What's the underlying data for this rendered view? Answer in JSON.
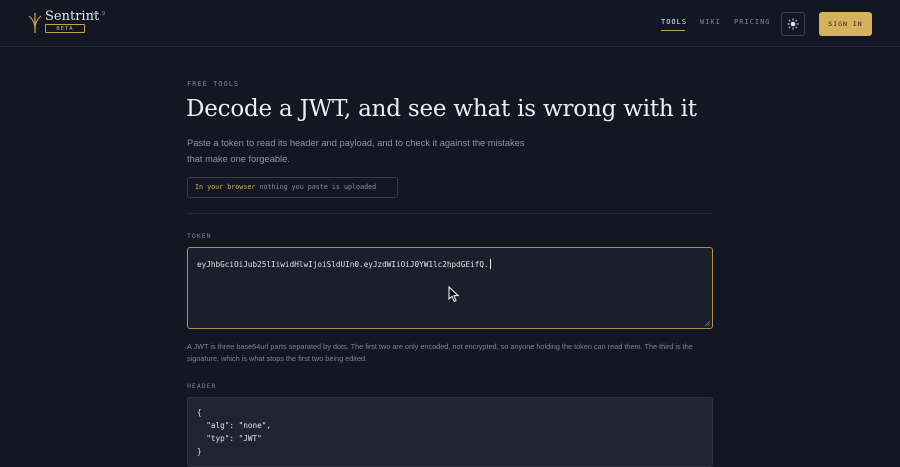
{
  "brand": {
    "name": "Sentrint",
    "version": "v0.9",
    "badge": "BETA"
  },
  "nav": {
    "links": [
      {
        "label": "TOOLS",
        "active": true
      },
      {
        "label": "WIKI",
        "active": false
      },
      {
        "label": "PRICING",
        "active": false
      }
    ],
    "theme_toggle_icon": "sun-icon",
    "signin_label": "SIGN IN"
  },
  "hero": {
    "eyebrow": "FREE TOOLS",
    "title": "Decode a JWT, and see what is wrong with it",
    "lead": "Paste a token to read its header and payload, and to check it against the mistakes that make one forgeable.",
    "privacy_highlight": "In your browser",
    "privacy_rest": " nothing you paste is uploaded"
  },
  "token": {
    "label": "TOKEN",
    "value": "eyJhbGciOiJub25lIiwidHlwIjoiSldUIn0.eyJzdWIiOiJ0YW1lc2hpdGEifQ.",
    "help": "A JWT is three base64url parts separated by dots. The first two are only encoded, not encrypted, so anyone holding the token can read them. The third is the signature, which is what stops the first two being edited."
  },
  "header_section": {
    "label": "HEADER",
    "code_lines": [
      "{",
      "  \"alg\": \"none\",",
      "  \"typ\": \"JWT\"",
      "}"
    ]
  },
  "colors": {
    "background": "#131722",
    "accent": "#d6b25e",
    "panel": "#1b1f2a"
  }
}
